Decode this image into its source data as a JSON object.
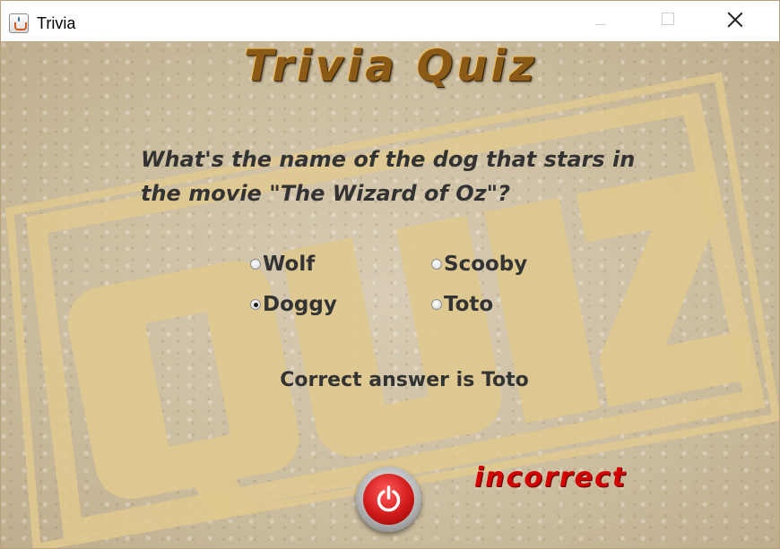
{
  "window": {
    "title": "Trivia"
  },
  "header": {
    "title": "Trivia Quiz"
  },
  "quiz": {
    "question": "What's the name of the dog that stars in the movie \"The Wizard of Oz\"?",
    "options": [
      {
        "label": "Wolf",
        "selected": false
      },
      {
        "label": "Scooby",
        "selected": false
      },
      {
        "label": "Doggy",
        "selected": true
      },
      {
        "label": "Toto",
        "selected": false
      }
    ],
    "answer_text": "Correct answer is Toto",
    "result_text": "incorrect"
  },
  "colors": {
    "background": "#cfc2a8",
    "stamp": "#e0c98f",
    "text": "#333333",
    "result": "#d40000",
    "power_button": "#d11a1a"
  },
  "icons": {
    "app": "java-cup-icon",
    "power": "power-icon",
    "stamp": "quiz-stamp"
  }
}
